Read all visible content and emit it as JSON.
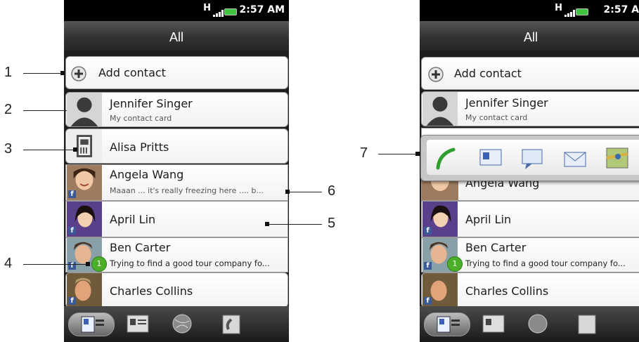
{
  "status": {
    "time": "2:57 AM",
    "network": "H"
  },
  "header": {
    "title": "All"
  },
  "contacts": {
    "add": "Add contact",
    "me": {
      "name": "Jennifer Singer",
      "sub": "My contact card"
    },
    "alisa": {
      "name": "Alisa Pritts"
    },
    "angela": {
      "name": "Angela Wang",
      "sub": "Maaan ... it's really freezing here .... b..."
    },
    "april": {
      "name": "April  Lin"
    },
    "ben": {
      "name": "Ben  Carter",
      "sub": "Trying to find a good tour company fo...",
      "badge": "1"
    },
    "charles": {
      "name": "Charles  Collins"
    }
  },
  "facebook_letter": "f",
  "callouts": [
    "1",
    "2",
    "3",
    "4",
    "5",
    "6",
    "7"
  ],
  "bottom_tabs": [
    "people-tab-icon",
    "groups-tab-icon",
    "online-directory-tab-icon",
    "call-history-tab-icon"
  ],
  "quick_contact": [
    "phone-icon",
    "contact-card-icon",
    "message-icon",
    "email-icon",
    "map-icon"
  ],
  "colors": {
    "status_bg": "#000000",
    "battery": "#3ec43e",
    "facebook": "#3b5998",
    "badge": "#4caf2a"
  }
}
